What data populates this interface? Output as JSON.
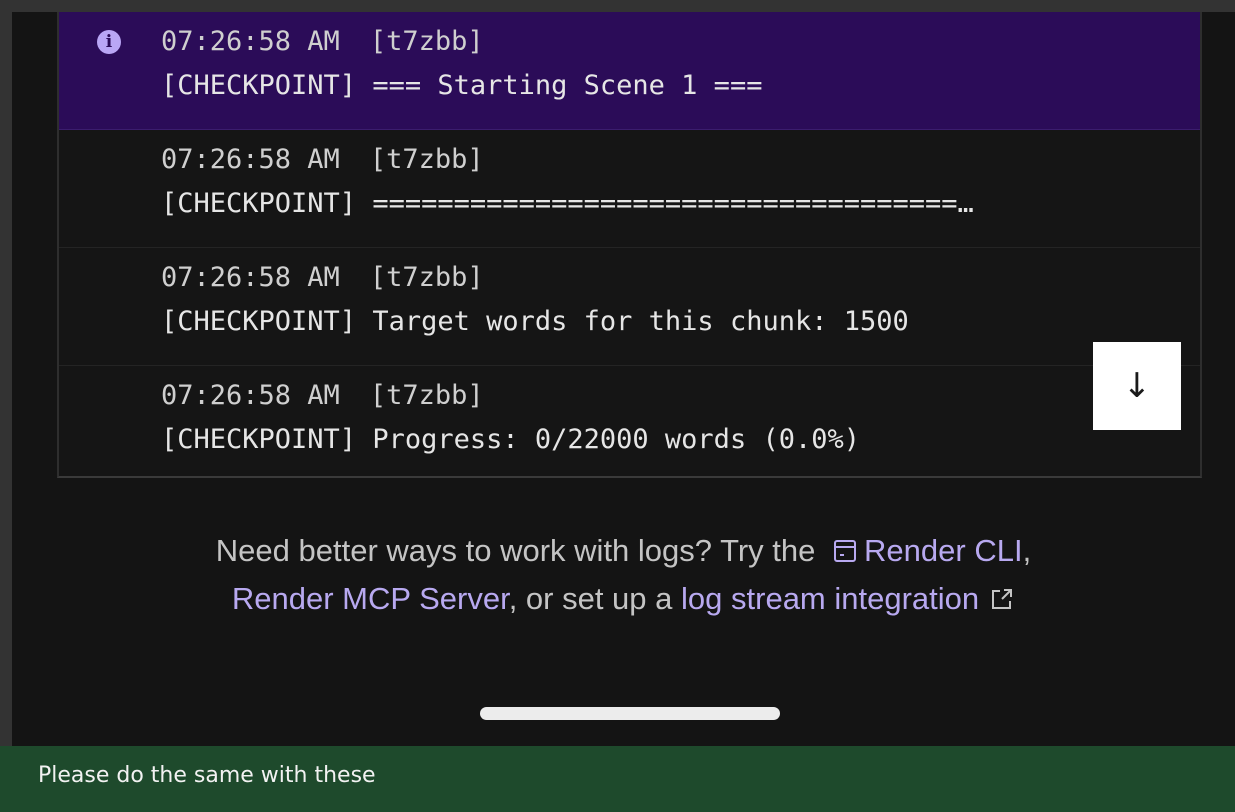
{
  "logs": [
    {
      "timestamp": "07:26:58 AM",
      "source": "[t7zbb]",
      "message": "[CHECKPOINT] === Starting Scene 1 ===",
      "highlighted": true,
      "level_icon": "info-icon"
    },
    {
      "timestamp": "07:26:58 AM",
      "source": "[t7zbb]",
      "message": "[CHECKPOINT] ====================================…",
      "highlighted": false
    },
    {
      "timestamp": "07:26:58 AM",
      "source": "[t7zbb]",
      "message": "[CHECKPOINT] Target words for this chunk: 1500",
      "highlighted": false
    },
    {
      "timestamp": "07:26:58 AM",
      "source": "[t7zbb]",
      "message": "[CHECKPOINT] Progress: 0/22000 words (0.0%)",
      "highlighted": false
    }
  ],
  "info_icon_glyph": "i",
  "scroll_button": {
    "icon": "arrow-down-icon",
    "glyph": "↓"
  },
  "promo": {
    "text_1": "Need better ways to work with logs? Try the",
    "link_cli": "Render CLI",
    "comma": ",",
    "link_mcp": "Render MCP Server",
    "text_2": ", or set up a",
    "link_stream": "log stream integration"
  },
  "caption": "Please do the same with these",
  "colors": {
    "highlight_bg": "#2b0c58",
    "link": "#b8a9f0",
    "caption_bg": "#1e4a2c"
  }
}
